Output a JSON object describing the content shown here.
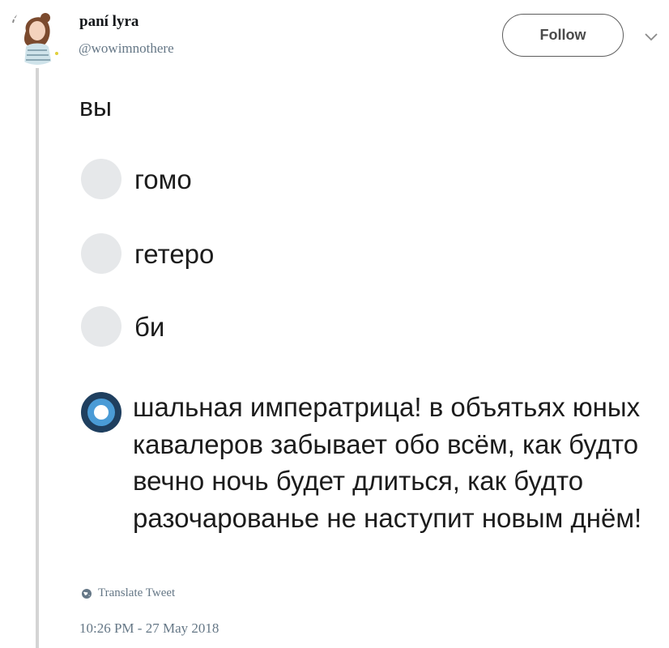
{
  "author": {
    "name": "paní lyra",
    "handle": "@wowimnothere"
  },
  "header": {
    "follow_label": "Follow",
    "more_icon": "chevron-down-icon"
  },
  "tweet": {
    "text": "вы"
  },
  "poll": {
    "options": [
      {
        "label": "гомо",
        "selected": false
      },
      {
        "label": "гетеро",
        "selected": false
      },
      {
        "label": "би",
        "selected": false
      },
      {
        "label": "шальная императрица! в объятьях юных кавалеров забывает обо всём, как будто вечно ночь будет длиться, как будто разочарованье не наступит новым днём!",
        "selected": true
      }
    ]
  },
  "footer": {
    "translate_label": "Translate Tweet",
    "timestamp": "10:26 PM - 27 May 2018"
  },
  "colors": {
    "text_primary": "#1c1c1c",
    "text_secondary": "#657786",
    "radio_unselected": "#e6e8ea",
    "radio_selected_ring": "#1f3f5f",
    "radio_selected_fill": "#4a9bd6",
    "thread_line": "#d4d4d4"
  }
}
